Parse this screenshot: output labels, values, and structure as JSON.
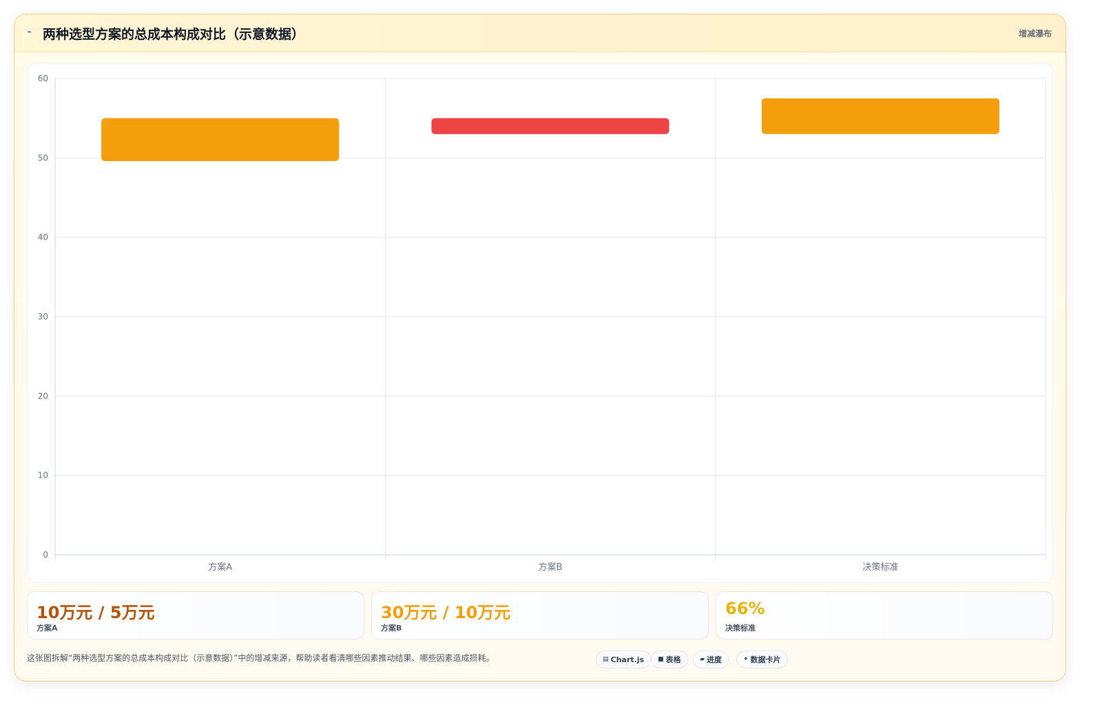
{
  "header": {
    "icon": "trend-icon",
    "title": "两种选型方案的总成本构成对比（示意数据）",
    "badge": "增减瀑布"
  },
  "chart_data": {
    "type": "bar",
    "subtype": "waterfall-floating",
    "categories": [
      "方案A",
      "方案B",
      "决策标准"
    ],
    "series": [
      {
        "ranges": [
          [
            49.6,
            55.0
          ],
          [
            53.0,
            55.0
          ],
          [
            53.0,
            57.5
          ]
        ],
        "colors": [
          "#f59e0b",
          "#ef4444",
          "#f59e0b"
        ]
      }
    ],
    "ylim": [
      0,
      60
    ],
    "yticks": [
      0,
      10,
      20,
      30,
      40,
      50,
      60
    ],
    "grid": true,
    "xlabel": "",
    "ylabel": ""
  },
  "stats": [
    {
      "value": "10万元 / 5万元",
      "label": "方案A",
      "color": "#b45309"
    },
    {
      "value": "30万元 / 10万元",
      "label": "方案B",
      "color": "#f59e0b"
    },
    {
      "value": "66%",
      "label": "决策标准",
      "color": "#eab308"
    }
  ],
  "footer": {
    "note": "这张图拆解“两种选型方案的总成本构成对比（示意数据）”中的增减来源，帮助读者看清哪些因素推动结果、哪些因素造成损耗。",
    "chips": [
      {
        "icon": "chart-icon",
        "glyph": "▤",
        "label": "Chart.js"
      },
      {
        "icon": "table-icon",
        "glyph": "■",
        "label": "表格"
      },
      {
        "icon": "progress-icon",
        "glyph": "▰",
        "label": "进度"
      },
      {
        "icon": "sparkle-icon",
        "glyph": "✦",
        "label": "数据卡片"
      }
    ]
  }
}
